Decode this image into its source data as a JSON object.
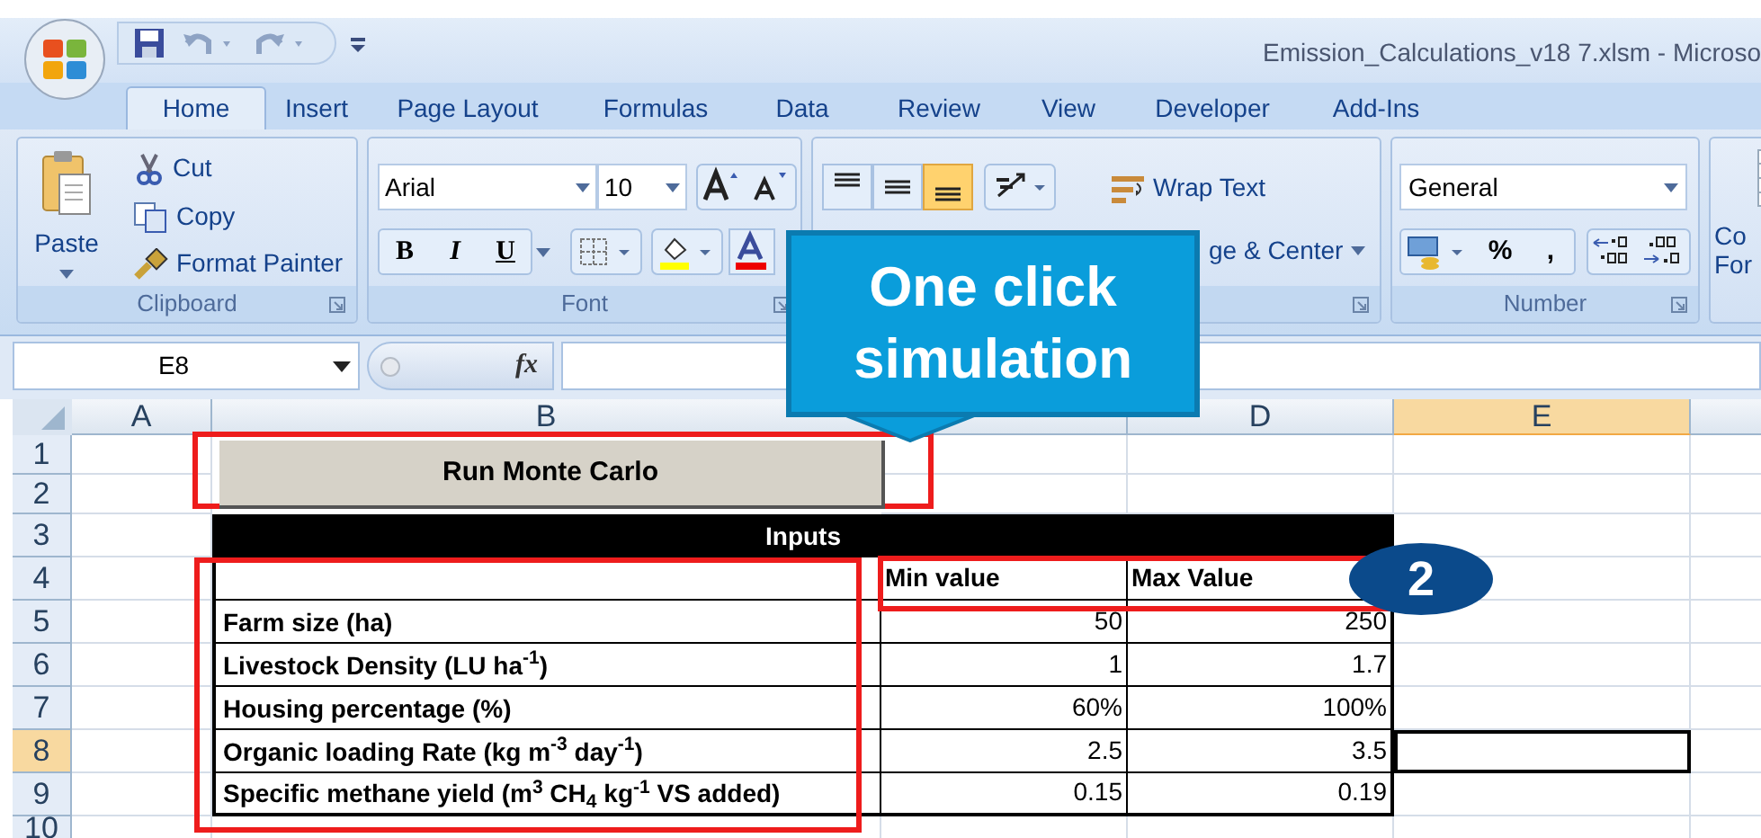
{
  "window": {
    "title": "Emission_Calculations_v18 7.xlsm - Microso"
  },
  "tabs": [
    {
      "label": "Home",
      "selected": true
    },
    {
      "label": "Insert",
      "selected": false
    },
    {
      "label": "Page Layout",
      "selected": false
    },
    {
      "label": "Formulas",
      "selected": false
    },
    {
      "label": "Data",
      "selected": false
    },
    {
      "label": "Review",
      "selected": false
    },
    {
      "label": "View",
      "selected": false
    },
    {
      "label": "Developer",
      "selected": false
    },
    {
      "label": "Add-Ins",
      "selected": false
    }
  ],
  "ribbon": {
    "clipboard": {
      "label": "Clipboard",
      "paste": "Paste",
      "cut": "Cut",
      "copy": "Copy",
      "format_painter": "Format Painter"
    },
    "font": {
      "label": "Font",
      "font_name": "Arial",
      "font_size": "10",
      "bold": "B",
      "italic": "I",
      "underline": "U"
    },
    "alignment": {
      "wrap_text": "Wrap Text",
      "merge_center": "ge & Center"
    },
    "number": {
      "label": "Number",
      "format": "General",
      "percent": "%",
      "comma": ","
    },
    "styles": {
      "line_1": "Co",
      "line_2": "For"
    }
  },
  "formula_bar": {
    "name_box": "E8",
    "function_label": "fx"
  },
  "sheet": {
    "columns": [
      {
        "label": "A",
        "selected": false
      },
      {
        "label": "B",
        "selected": false
      },
      {
        "selected": false
      },
      {
        "label": "D",
        "selected": false
      },
      {
        "label": "E",
        "selected": true
      }
    ],
    "rows": [
      {
        "label": "1",
        "selected": false
      },
      {
        "label": "2",
        "selected": false
      },
      {
        "label": "3",
        "selected": false
      },
      {
        "label": "4",
        "selected": false
      },
      {
        "label": "5",
        "selected": false
      },
      {
        "label": "6",
        "selected": false
      },
      {
        "label": "7",
        "selected": false
      },
      {
        "label": "8",
        "selected": true
      },
      {
        "label": "9",
        "selected": false
      },
      {
        "label": "10",
        "selected": false
      }
    ]
  },
  "macro_button": {
    "label": "Run Monte Carlo"
  },
  "inputs_table": {
    "title": "Inputs",
    "headers": [
      "Min value",
      "Max Value"
    ],
    "rows": [
      {
        "label": "Farm size (ha)",
        "min": "50",
        "max": "250"
      },
      {
        "label": "Livestock Density (LU ha$^{-1}$)",
        "min": "1",
        "max": "1.7"
      },
      {
        "label": "Housing percentage (%)",
        "min": "60%",
        "max": "100%"
      },
      {
        "label": "Organic loading Rate (kg m$^{-3}$ day$^{-1}$)",
        "min": "2.5",
        "max": "3.5"
      },
      {
        "label": "Specific methane yield (m$^{3}$ CH$_{4}$ kg$^{-1}$ VS added)",
        "min": "0.15",
        "max": "0.19"
      }
    ]
  },
  "annotations": {
    "callout": [
      "One click",
      "simulation"
    ],
    "badge": "2"
  }
}
